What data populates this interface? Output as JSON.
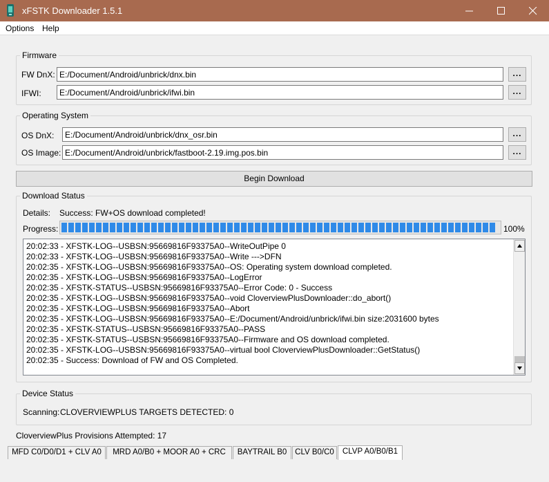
{
  "window": {
    "title": "xFSTK Downloader 1.5.1"
  },
  "menu": {
    "options": "Options",
    "help": "Help"
  },
  "firmware": {
    "legend": "Firmware",
    "fw_dnx_label": "FW DnX:",
    "fw_dnx_value": "E:/Document/Android/unbrick/dnx.bin",
    "ifwi_label": "IFWI:",
    "ifwi_value": "E:/Document/Android/unbrick/ifwi.bin"
  },
  "os": {
    "legend": "Operating System",
    "os_dnx_label": "OS DnX:",
    "os_dnx_value": "E:/Document/Android/unbrick/dnx_osr.bin",
    "os_image_label": "OS Image:",
    "os_image_value": "E:/Document/Android/unbrick/fastboot-2.19.img.pos.bin"
  },
  "browse_label": "...",
  "begin_download_label": "Begin Download",
  "download_status": {
    "legend": "Download Status",
    "details_label": "Details:",
    "details_value": "Success: FW+OS download completed!",
    "progress_label": "Progress:",
    "progress_percent": 100,
    "progress_text": "100%",
    "log": [
      "20:02:33 - XFSTK-LOG--USBSN:95669816F93375A0--WriteOutPipe 0",
      "20:02:33 - XFSTK-LOG--USBSN:95669816F93375A0--Write --->DFN",
      "20:02:35 - XFSTK-LOG--USBSN:95669816F93375A0--OS: Operating system download completed.",
      "20:02:35 - XFSTK-LOG--USBSN:95669816F93375A0--LogError",
      "20:02:35 - XFSTK-STATUS--USBSN:95669816F93375A0--Error Code: 0 - Success",
      "20:02:35 - XFSTK-LOG--USBSN:95669816F93375A0--void CloverviewPlusDownloader::do_abort()",
      "20:02:35 - XFSTK-LOG--USBSN:95669816F93375A0--Abort",
      "20:02:35 - XFSTK-LOG--USBSN:95669816F93375A0--E:/Document/Android/unbrick/ifwi.bin size:2031600 bytes",
      "20:02:35 - XFSTK-STATUS--USBSN:95669816F93375A0--PASS",
      "20:02:35 - XFSTK-STATUS--USBSN:95669816F93375A0--Firmware and OS download completed.",
      "20:02:35 - XFSTK-LOG--USBSN:95669816F93375A0--virtual bool CloverviewPlusDownloader::GetStatus()",
      "20:02:35 - Success: Download of FW and OS Completed."
    ]
  },
  "device_status": {
    "legend": "Device Status",
    "scanning_label": "Scanning:",
    "scanning_value": "CLOVERVIEWPLUS TARGETS DETECTED: 0"
  },
  "provisions": "CloverviewPlus Provisions Attempted: 17",
  "tabs": [
    "MFD C0/D0/D1 + CLV A0",
    "MRD A0/B0 + MOOR A0 + CRC",
    "BAYTRAIL B0",
    "CLV B0/C0",
    "CLVP A0/B0/B1"
  ],
  "colors": {
    "titlebar": "#a86a4f",
    "progress": "#2f8ae8"
  },
  "icons": [
    "app-icon",
    "minimize-icon",
    "maximize-icon",
    "close-icon",
    "scroll-up-icon",
    "scroll-down-icon"
  ]
}
